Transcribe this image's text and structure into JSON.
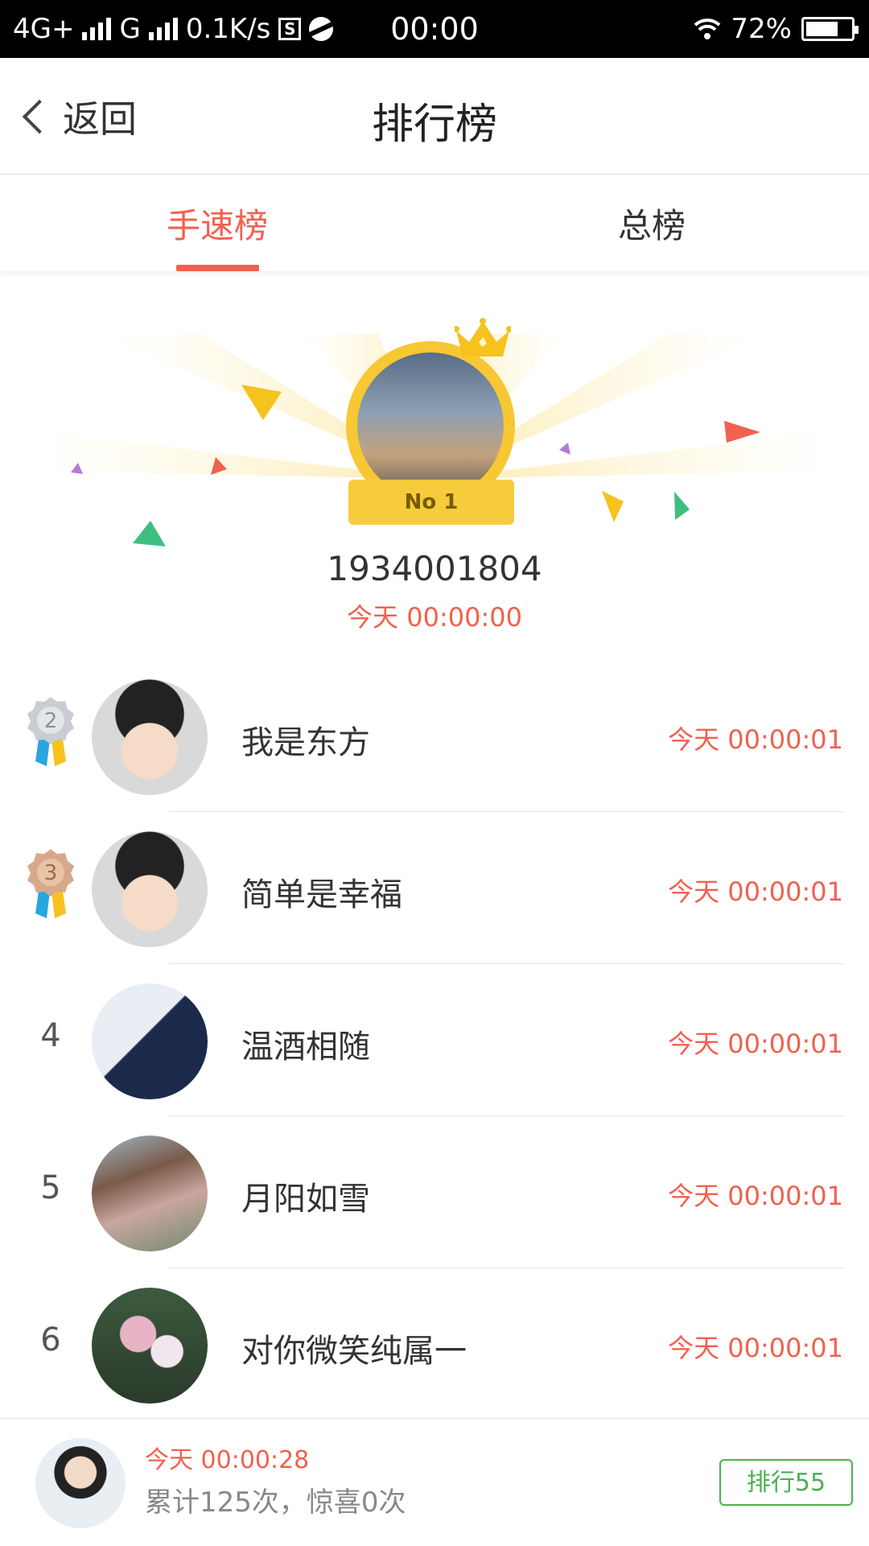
{
  "status_bar": {
    "network1": "4G+",
    "network2": "G",
    "speed": "0.1K/s",
    "time": "00:00",
    "battery": "72%",
    "battery_level": 0.72
  },
  "nav": {
    "back_label": "返回",
    "title": "排行榜"
  },
  "tabs": [
    {
      "label": "手速榜",
      "active": true
    },
    {
      "label": "总榜",
      "active": false
    }
  ],
  "winner": {
    "badge": "No 1",
    "name": "1934001804",
    "time": "今天 00:00:00"
  },
  "ranking": [
    {
      "rank": "2",
      "name": "我是东方",
      "time": "今天 00:00:01"
    },
    {
      "rank": "3",
      "name": "简单是幸福",
      "time": "今天 00:00:01"
    },
    {
      "rank": "4",
      "name": "温酒相随",
      "time": "今天 00:00:01"
    },
    {
      "rank": "5",
      "name": "月阳如雪",
      "time": "今天 00:00:01"
    },
    {
      "rank": "6",
      "name": "对你微笑纯属一",
      "time": "今天 00:00:01"
    }
  ],
  "my_stats": {
    "time": "今天 00:00:28",
    "summary": "累计125次，惊喜0次",
    "rank_button": "排行55"
  },
  "colors": {
    "accent": "#f0614f",
    "gold": "#f7c833",
    "green": "#4cb050"
  }
}
